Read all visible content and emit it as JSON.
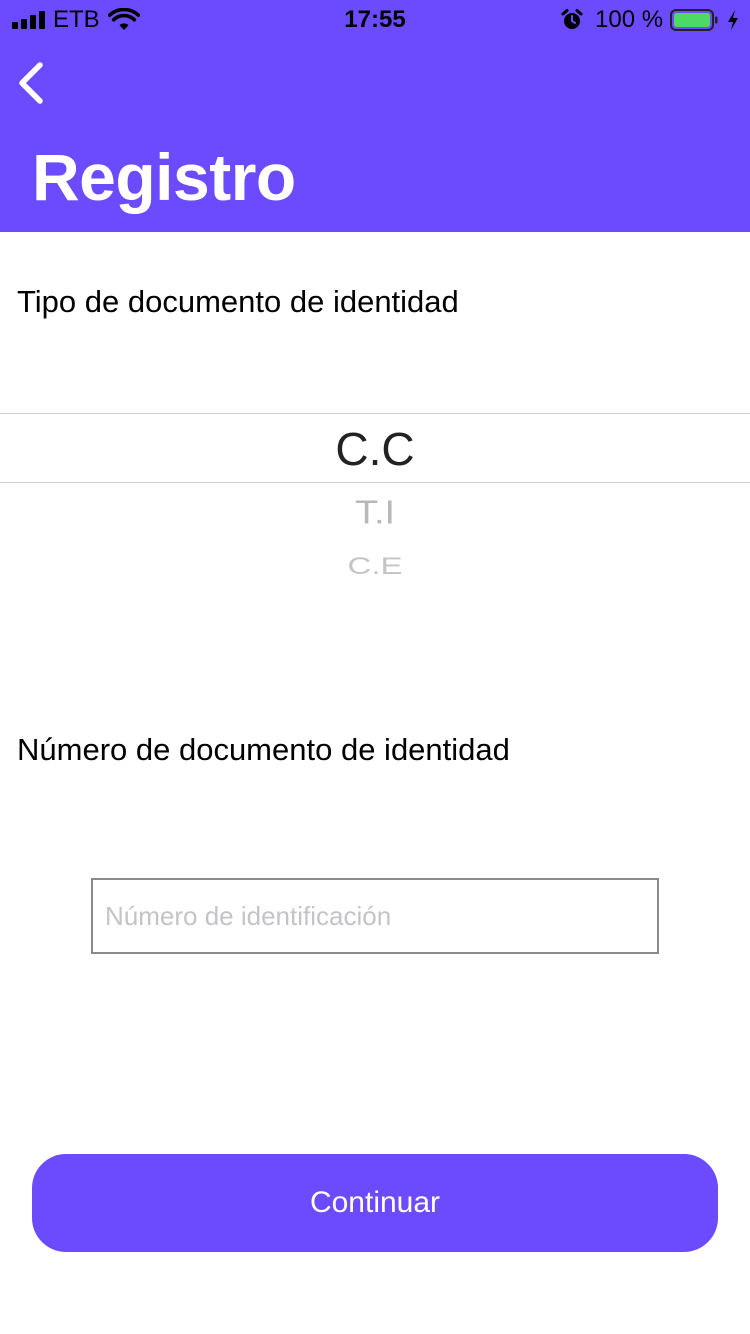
{
  "status_bar": {
    "carrier": "ETB",
    "time": "17:55",
    "battery_percent": "100 %",
    "icons": [
      "signal-bars-icon",
      "wifi-icon",
      "alarm-icon",
      "battery-icon",
      "charging-bolt-icon"
    ]
  },
  "header": {
    "title": "Registro",
    "back_icon": "chevron-left-icon",
    "background_color": "#6c4bff"
  },
  "form": {
    "document_type_label": "Tipo de documento de identidad",
    "document_type_options": [
      "C.C",
      "T.I",
      "C.E"
    ],
    "document_type_selected": "C.C",
    "document_number_label": "Número de documento de identidad",
    "document_number_placeholder": "Número de identificación",
    "document_number_value": ""
  },
  "actions": {
    "continue_label": "Continuar",
    "accent_color": "#6c4bff"
  }
}
